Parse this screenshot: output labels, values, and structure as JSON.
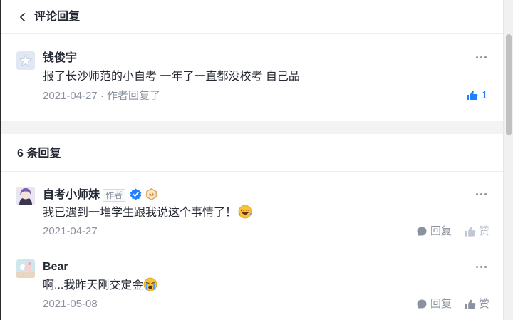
{
  "header": {
    "title": "评论回复"
  },
  "main_comment": {
    "author": "钱俊宇",
    "content": "报了长沙师范的小自考 一年了一直都没校考 自己品",
    "meta": "2021-04-27 · 作者回复了",
    "like_count": "1"
  },
  "replies_header": {
    "count_label": "6 条回复"
  },
  "replies": [
    {
      "author": "自考小师妹",
      "author_tag": "作者",
      "content": "我已遇到一堆学生跟我说这个事情了！",
      "date": "2021-04-27",
      "reply_label": "回复",
      "like_label": "赞"
    },
    {
      "author": "Bear",
      "content": "啊...我昨天刚交定金",
      "date": "2021-05-08",
      "reply_label": "回复",
      "like_label": "赞"
    }
  ],
  "colors": {
    "accent": "#1e80ff",
    "muted": "#8a919f",
    "text": "#252933",
    "divider": "#f2f3f5"
  }
}
